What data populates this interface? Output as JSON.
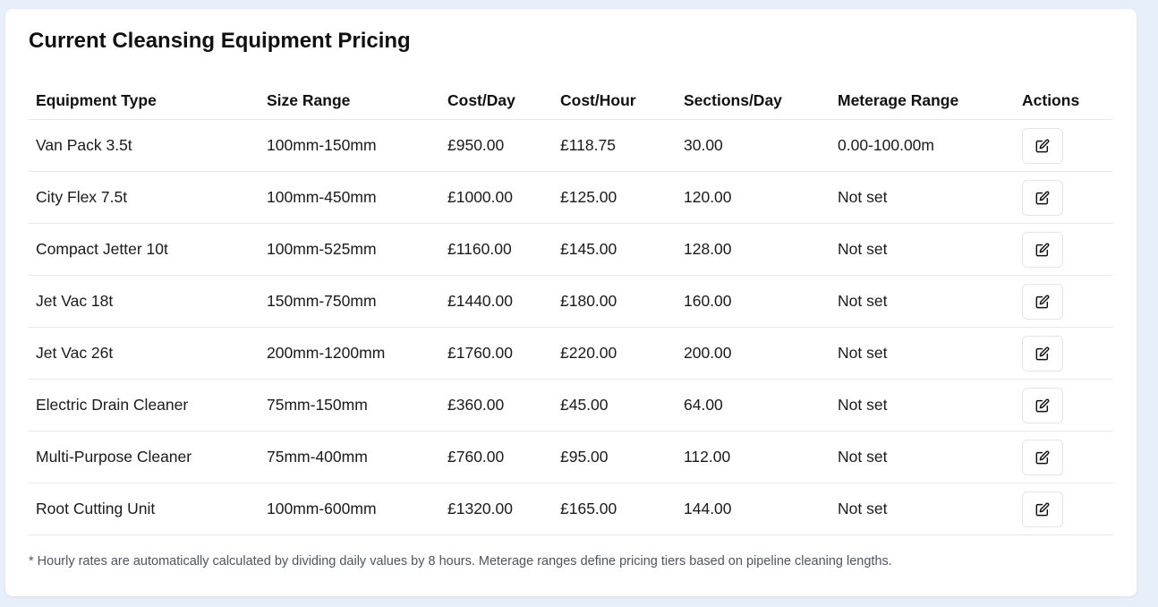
{
  "title": "Current Cleansing Equipment Pricing",
  "table": {
    "headers": [
      "Equipment Type",
      "Size Range",
      "Cost/Day",
      "Cost/Hour",
      "Sections/Day",
      "Meterage Range",
      "Actions"
    ],
    "rows": [
      [
        "Van Pack 3.5t",
        "100mm-150mm",
        "£950.00",
        "£118.75",
        "30.00",
        "0.00-100.00m"
      ],
      [
        "City Flex 7.5t",
        "100mm-450mm",
        "£1000.00",
        "£125.00",
        "120.00",
        "Not set"
      ],
      [
        "Compact Jetter 10t",
        "100mm-525mm",
        "£1160.00",
        "£145.00",
        "128.00",
        "Not set"
      ],
      [
        "Jet Vac 18t",
        "150mm-750mm",
        "£1440.00",
        "£180.00",
        "160.00",
        "Not set"
      ],
      [
        "Jet Vac 26t",
        "200mm-1200mm",
        "£1760.00",
        "£220.00",
        "200.00",
        "Not set"
      ],
      [
        "Electric Drain Cleaner",
        "75mm-150mm",
        "£360.00",
        "£45.00",
        "64.00",
        "Not set"
      ],
      [
        "Multi-Purpose Cleaner",
        "75mm-400mm",
        "£760.00",
        "£95.00",
        "112.00",
        "Not set"
      ],
      [
        "Root Cutting Unit",
        "100mm-600mm",
        "£1320.00",
        "£165.00",
        "144.00",
        "Not set"
      ]
    ],
    "action_icon": "edit-icon"
  },
  "footnote": "* Hourly rates are automatically calculated by dividing daily values by 8 hours. Meterage ranges define pricing tiers based on pipeline cleaning lengths.",
  "colors": {
    "page_background": "#e6effa",
    "card_background": "#ffffff",
    "divider": "#e7e9ee",
    "footnote_text": "#4b5563"
  }
}
